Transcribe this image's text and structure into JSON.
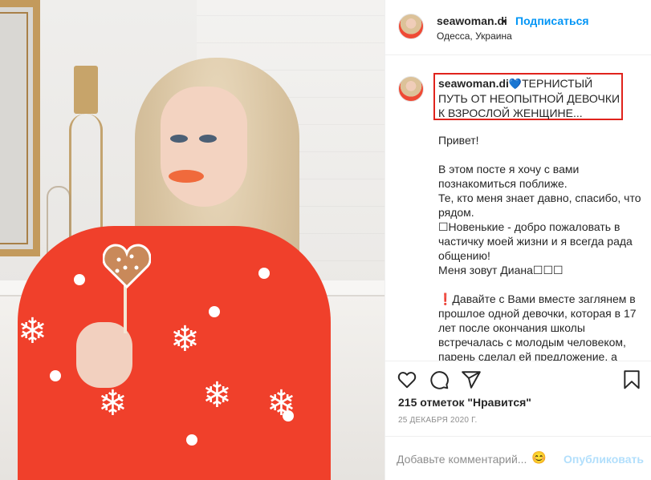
{
  "post": {
    "username": "seawoman.di",
    "header_dot": "•",
    "follow_label": "Подписаться",
    "location": "Одесса, Украина",
    "image_alt": "Фото: девушка в красном свитере с пряником-сердечком"
  },
  "caption": {
    "username": "seawoman.di",
    "icon": "💙",
    "first_line": "ТЕРНИСТЫЙ ПУТЬ ОТ НЕОПЫТНОЙ ДЕВОЧКИ К ВЗРОСЛОЙ ЖЕНЩИНЕ...",
    "paragraphs": [
      "Привет!",
      "В этом посте я хочу с вами познакомиться поближе.\nТе, кто меня знает давно, спасибо, что рядом.\n☐Новенькие - добро пожаловать в частичку моей жизни и я всегда рада общению!\nМеня зовут Диана☐☐☐",
      "❗Давайте с Вами вместе заглянем в прошлое одной девочки, которая в 17 лет после окончания школы встречалась с молодым человеком, парень сделал ей предложение, а"
    ]
  },
  "actions": {
    "icons": [
      "heart-icon",
      "comment-icon",
      "share-icon",
      "bookmark-icon"
    ],
    "likes_text": "215 отметок \"Нравится\"",
    "date": "25 ДЕКАБРЯ 2020 Г."
  },
  "comment_form": {
    "placeholder": "Добавьте комментарий...",
    "emoji": "😊",
    "publish_label": "Опубликовать"
  },
  "colors": {
    "accent": "#0095f6",
    "publish_disabled": "#b2dffc",
    "highlight_border": "#e0231c",
    "sweater": "#f0402b"
  }
}
